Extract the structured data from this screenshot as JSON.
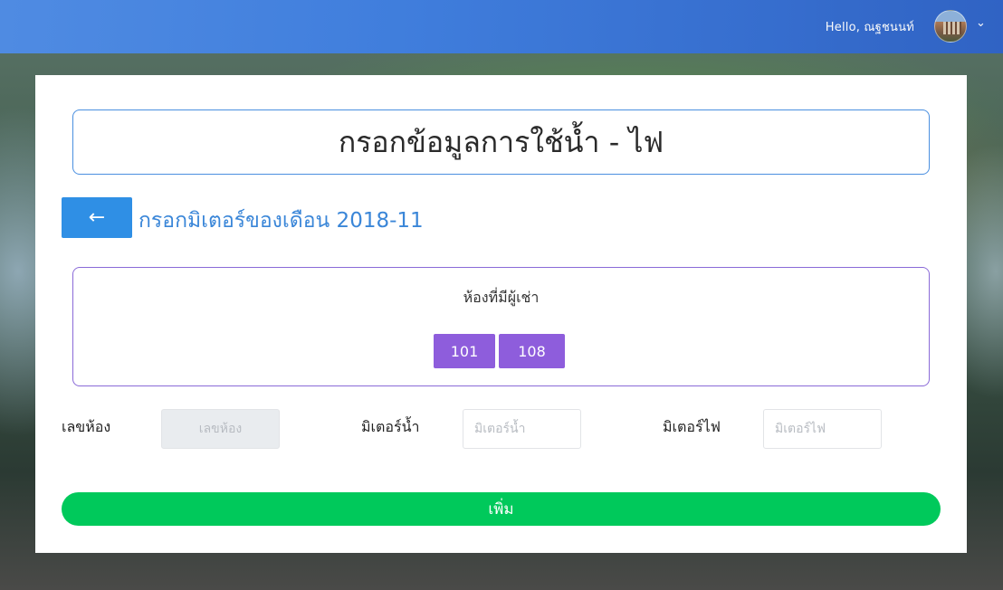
{
  "header": {
    "greeting": "Hello, ณฐชนนท์",
    "user_menu_icon": "chevron-down-icon",
    "chevron_glyph": "⌄"
  },
  "form": {
    "title": "กรอกข้อมูลการใช้น้ำ - ไฟ",
    "back_icon": "arrow-left-icon",
    "back_glyph": "←",
    "subtitle": "กรอกมิเตอร์ของเดือน 2018-11"
  },
  "rooms": {
    "label": "ห้องที่มีผู้เช่า",
    "items": [
      "101",
      "108"
    ]
  },
  "fields": {
    "room": {
      "label": "เลขห้อง",
      "placeholder": "เลขห้อง"
    },
    "water": {
      "label": "มิเตอร์น้ำ",
      "placeholder": "มิเตอร์น้ำ"
    },
    "electric": {
      "label": "มิเตอร์ไฟ",
      "placeholder": "มิเตอร์ไฟ"
    }
  },
  "actions": {
    "add_label": "เพิ่ม"
  },
  "colors": {
    "header": "#3f7ee0",
    "primary": "#2f8fe5",
    "room_button": "#8e5ddc",
    "add_button": "#00c95b"
  }
}
